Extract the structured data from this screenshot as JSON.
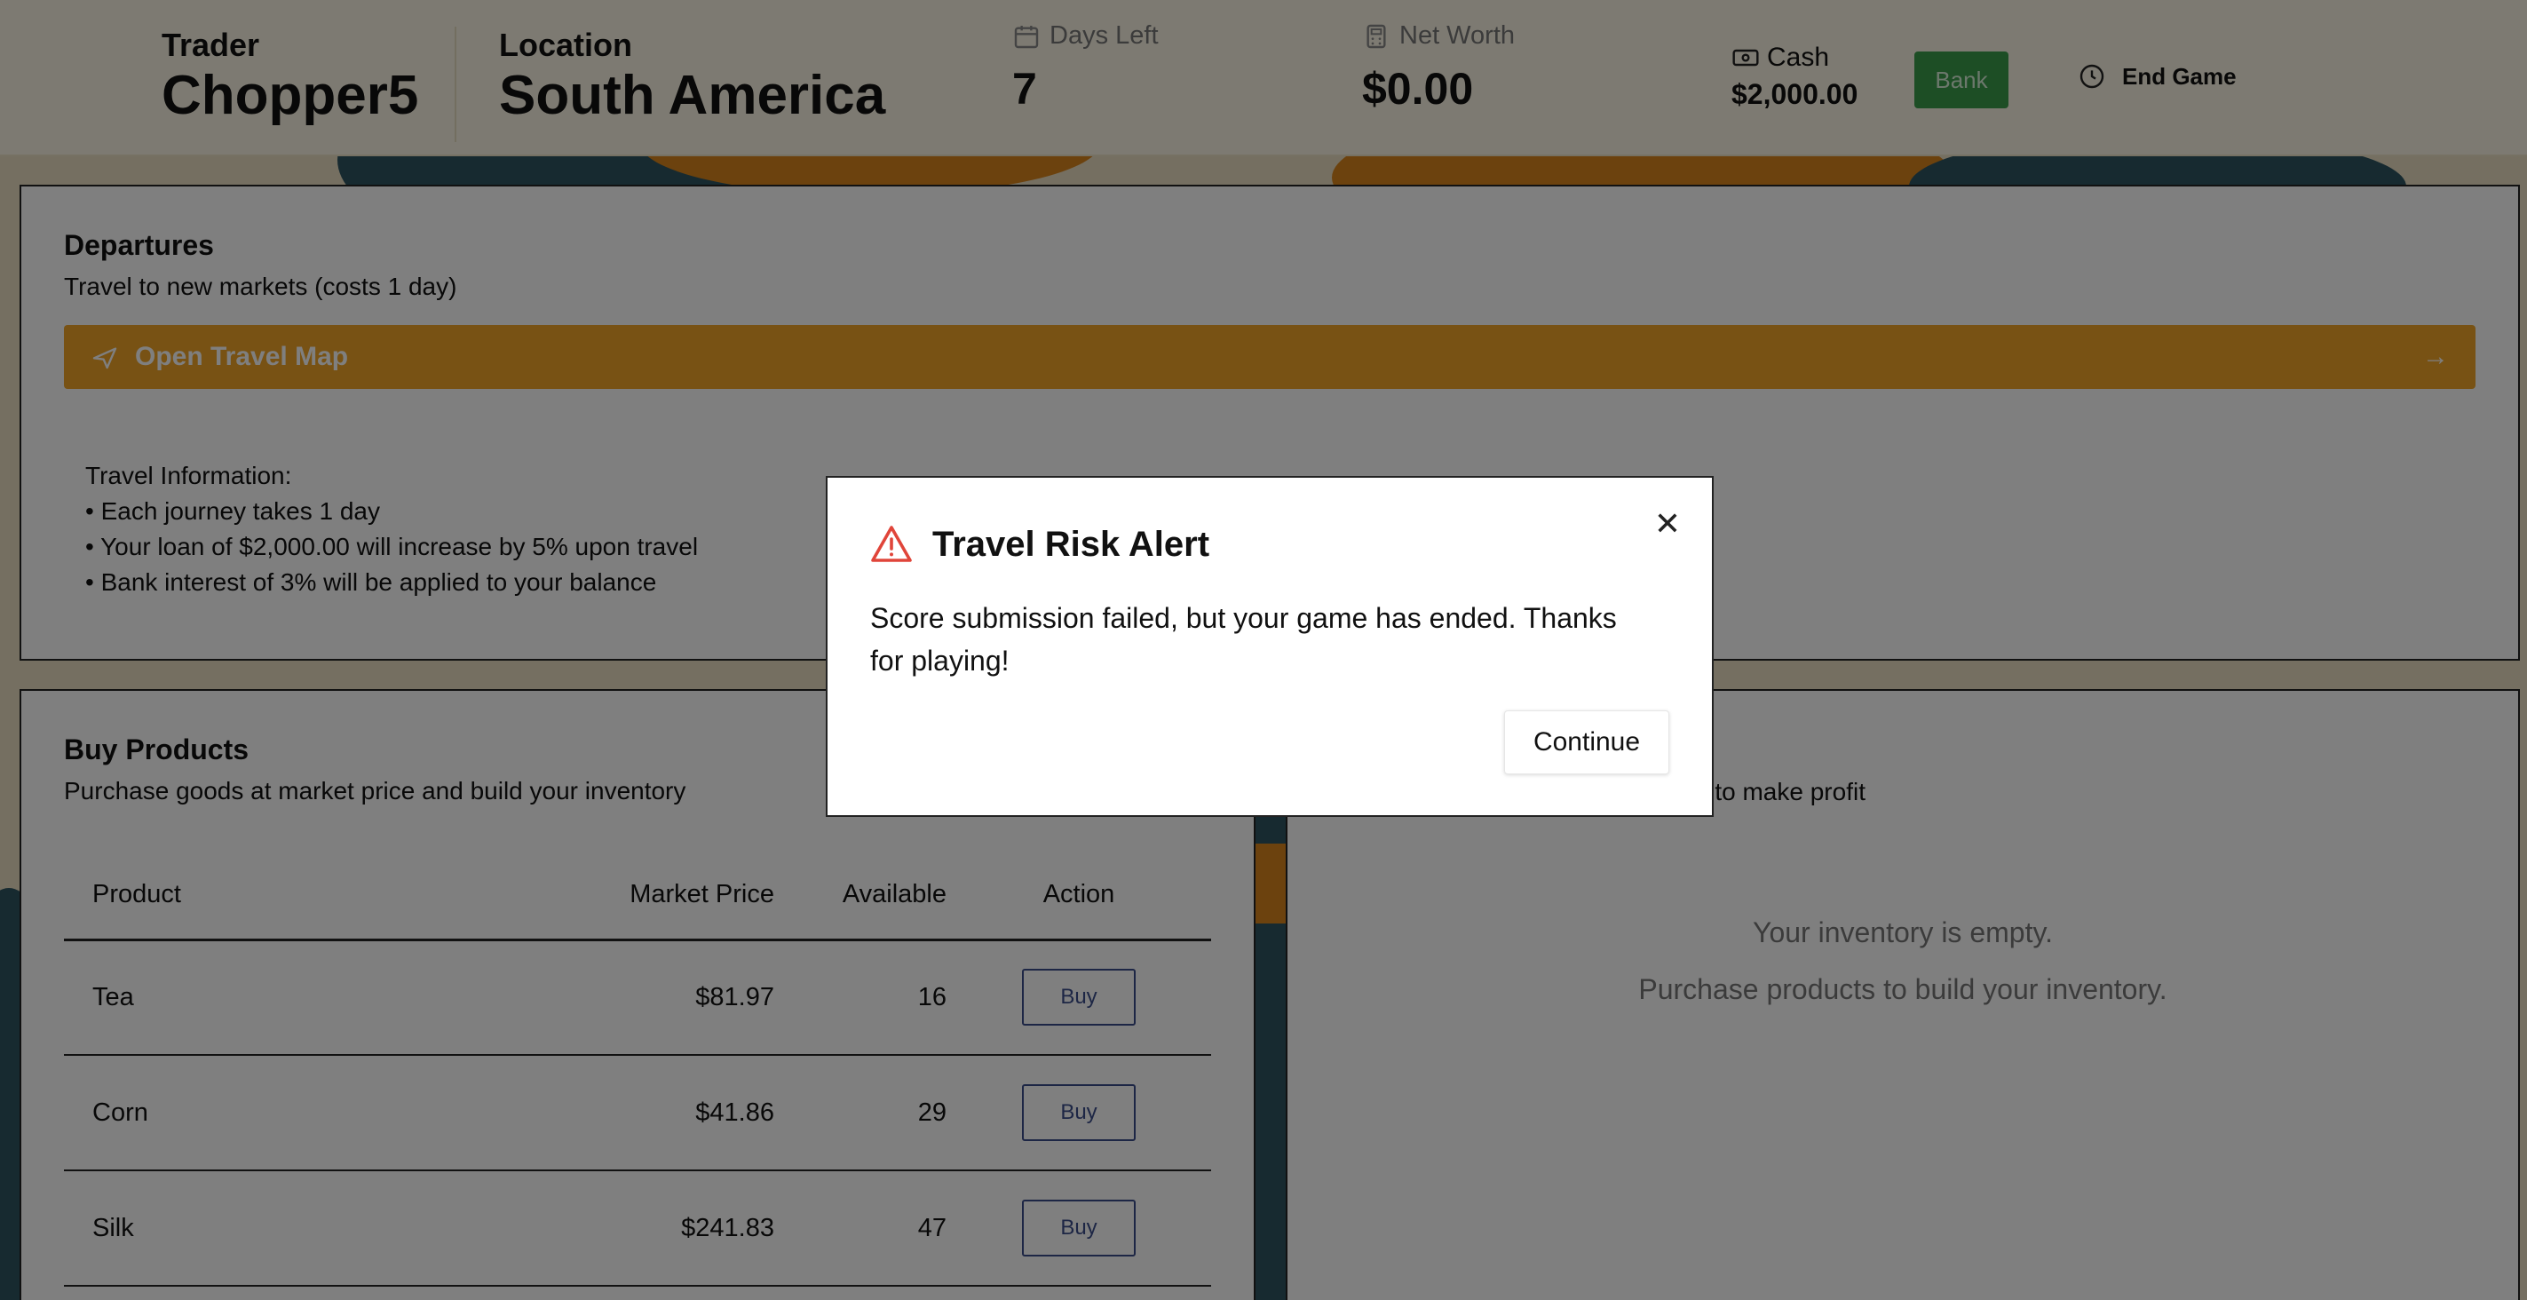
{
  "header": {
    "trader_label": "Trader",
    "trader_name": "Chopper5",
    "location_label": "Location",
    "location_name": "South America",
    "days_left_label": "Days Left",
    "days_left_value": "7",
    "net_worth_label": "Net Worth",
    "net_worth_value": "$0.00",
    "cash_label": "Cash",
    "cash_value": "$2,000.00",
    "bank_label": "Bank",
    "end_game_label": "End Game"
  },
  "departures": {
    "title": "Departures",
    "subtitle": "Travel to new markets (costs 1 day)",
    "travel_button": "Open Travel Map",
    "info_title": "Travel Information:",
    "info_items": [
      "• Each journey takes 1 day",
      "• Your loan of $2,000.00 will increase by 5% upon travel",
      "• Bank interest of 3% will be applied to your balance"
    ]
  },
  "buy": {
    "title": "Buy Products",
    "subtitle": "Purchase goods at market price and build your inventory",
    "columns": [
      "Product",
      "Market Price",
      "Available",
      "Action"
    ],
    "rows": [
      {
        "product": "Tea",
        "price": "$81.97",
        "available": "16",
        "action": "Buy"
      },
      {
        "product": "Corn",
        "price": "$41.86",
        "available": "29",
        "action": "Buy"
      },
      {
        "product": "Silk",
        "price": "$241.83",
        "available": "47",
        "action": "Buy"
      }
    ]
  },
  "sell": {
    "subtitle_partial": "ces to make profit",
    "empty_line1": "Your inventory is empty.",
    "empty_line2": "Purchase products to build your inventory."
  },
  "modal": {
    "title": "Travel Risk Alert",
    "body": "Score submission failed, but your game has ended. Thanks for playing!",
    "continue_label": "Continue",
    "close_symbol": "✕"
  },
  "colors": {
    "travel_bar": "#f0a528",
    "bank_button": "#3a9c4a",
    "buy_button": "#3a4c8a",
    "alert_icon": "#e0453a"
  }
}
